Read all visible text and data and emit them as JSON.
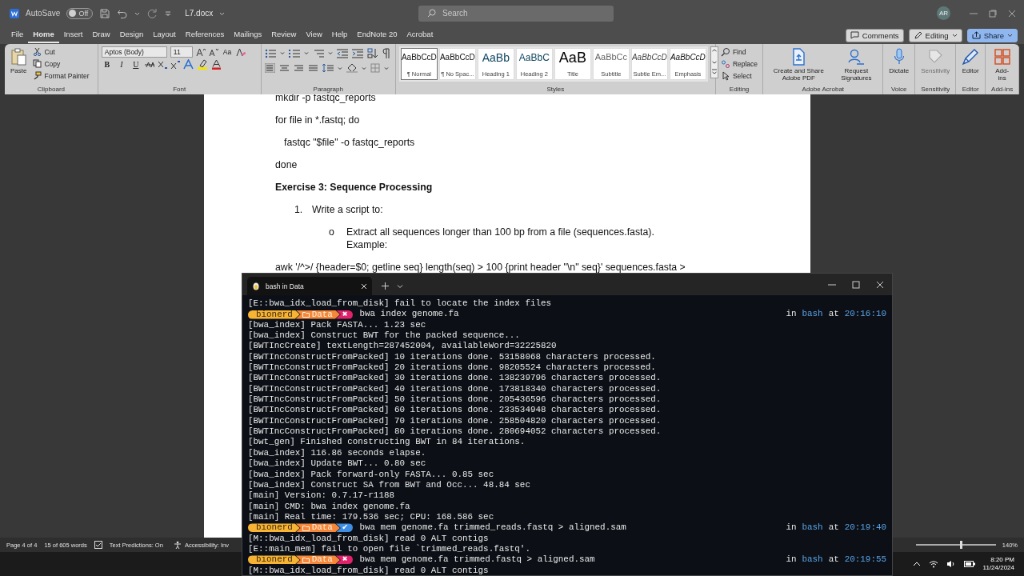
{
  "title_bar": {
    "autosave_label": "AutoSave",
    "autosave": {
      "label": "Off",
      "on": false
    },
    "document_name": "L7.docx",
    "search": {
      "placeholder": "Search"
    },
    "avatar": "AR"
  },
  "ribbon_tabs": [
    {
      "label": "File",
      "selected": false
    },
    {
      "label": "Home",
      "selected": true
    },
    {
      "label": "Insert",
      "selected": false
    },
    {
      "label": "Draw",
      "selected": false
    },
    {
      "label": "Design",
      "selected": false
    },
    {
      "label": "Layout",
      "selected": false
    },
    {
      "label": "References",
      "selected": false
    },
    {
      "label": "Mailings",
      "selected": false
    },
    {
      "label": "Review",
      "selected": false
    },
    {
      "label": "View",
      "selected": false
    },
    {
      "label": "Help",
      "selected": false
    },
    {
      "label": "EndNote 20",
      "selected": false
    },
    {
      "label": "Acrobat",
      "selected": false
    }
  ],
  "ribbon_actions": [
    {
      "label": "Comments",
      "kind": "comments"
    },
    {
      "label": "Editing",
      "kind": "editing"
    },
    {
      "label": "Share",
      "kind": "share"
    }
  ],
  "ribbon": {
    "clipboard": {
      "label": "Clipboard",
      "paste": "Paste",
      "cut": "Cut",
      "copy": "Copy",
      "format_painter": "Format Painter"
    },
    "font": {
      "label": "Font",
      "font_name": "Aptos (Body)",
      "font_size": "11",
      "change_case": "Aa",
      "bold": "B",
      "italic": "I",
      "underline": "U"
    },
    "paragraph": {
      "label": "Paragraph"
    },
    "styles": {
      "label": "Styles",
      "items": [
        {
          "preview": "AaBbCcD",
          "name": "¶ Normal",
          "kind": "normal",
          "selected": true
        },
        {
          "preview": "AaBbCcD",
          "name": "¶ No Spac...",
          "kind": "normal",
          "selected": false
        },
        {
          "preview": "AaBb",
          "name": "Heading 1",
          "kind": "heading1",
          "selected": false
        },
        {
          "preview": "AaBbC",
          "name": "Heading 2",
          "kind": "heading2",
          "selected": false
        },
        {
          "preview": "AaB",
          "name": "Title",
          "kind": "title",
          "selected": false
        },
        {
          "preview": "AaBbCc",
          "name": "Subtitle",
          "kind": "subtitle",
          "selected": false
        },
        {
          "preview": "AaBbCcD",
          "name": "Subtle Em...",
          "kind": "subtle",
          "selected": false
        },
        {
          "preview": "AaBbCcD",
          "name": "Emphasis",
          "kind": "emphasis",
          "selected": false
        }
      ]
    },
    "editing": {
      "label": "Editing",
      "items": [
        {
          "label": "Find",
          "kind": "find"
        },
        {
          "label": "Replace",
          "kind": "replace"
        },
        {
          "label": "Select",
          "kind": "select"
        }
      ]
    },
    "groups": [
      {
        "label": "Adobe Acrobat",
        "buttons": [
          {
            "label": "Create and Share Adobe PDF",
            "kind": "pdf",
            "disabled": false
          },
          {
            "label": "Request Signatures",
            "kind": "sign",
            "disabled": false
          }
        ]
      },
      {
        "label": "Voice",
        "buttons": [
          {
            "label": "Dictate",
            "kind": "mic",
            "disabled": false
          }
        ]
      },
      {
        "label": "Sensitivity",
        "buttons": [
          {
            "label": "Sensitivity",
            "kind": "sensitivity",
            "disabled": true
          }
        ]
      },
      {
        "label": "Editor",
        "buttons": [
          {
            "label": "Editor",
            "kind": "editor",
            "disabled": false
          }
        ]
      },
      {
        "label": "Add-ins",
        "buttons": [
          {
            "label": "Add-ins",
            "kind": "addins",
            "disabled": false
          }
        ]
      }
    ]
  },
  "document": {
    "paragraphs": [
      {
        "kind": "plain",
        "text": "mkdir -p fastqc_reports"
      },
      {
        "kind": "plain",
        "text": "for file in *.fastq; do"
      },
      {
        "kind": "indented",
        "text": "fastqc \"$file\" -o fastqc_reports"
      },
      {
        "kind": "plain",
        "text": "done"
      },
      {
        "kind": "heading",
        "text": "Exercise 3: Sequence Processing"
      },
      {
        "kind": "numbered",
        "marker": "1.",
        "text": "Write a script to:"
      },
      {
        "kind": "bullet",
        "marker": "o",
        "text": "Extract all sequences longer than 100 bp from a file (sequences.fasta). Example:"
      },
      {
        "kind": "plain",
        "text": "awk '/^>/ {header=$0; getline seq} length(seq) > 100 {print header \"\\n\" seq}' sequences.fasta >"
      }
    ]
  },
  "terminal": {
    "tab_title": "bash in Data",
    "lines": [
      {
        "kind": "output",
        "text": "[E::bwa_idx_load_from_disk] fail to locate the index files"
      },
      {
        "kind": "prompt",
        "user": "bionerd",
        "dir": "Data",
        "failed": true,
        "status_symbol": "✖",
        "command": "bwa index genome.fa",
        "right": [
          {
            "text": "in",
            "accent": false
          },
          {
            "text": "bash",
            "accent": true
          },
          {
            "text": "at",
            "accent": false
          },
          {
            "text": "20:16:10",
            "accent": true
          }
        ]
      },
      {
        "kind": "output",
        "text": "[bwa_index] Pack FASTA... 1.23 sec"
      },
      {
        "kind": "output",
        "text": "[bwa_index] Construct BWT for the packed sequence..."
      },
      {
        "kind": "output",
        "text": "[BWTIncCreate] textLength=287452004, availableWord=32225820"
      },
      {
        "kind": "output",
        "text": "[BWTIncConstructFromPacked] 10 iterations done. 53158068 characters processed."
      },
      {
        "kind": "output",
        "text": "[BWTIncConstructFromPacked] 20 iterations done. 98205524 characters processed."
      },
      {
        "kind": "output",
        "text": "[BWTIncConstructFromPacked] 30 iterations done. 138239796 characters processed."
      },
      {
        "kind": "output",
        "text": "[BWTIncConstructFromPacked] 40 iterations done. 173818340 characters processed."
      },
      {
        "kind": "output",
        "text": "[BWTIncConstructFromPacked] 50 iterations done. 205436596 characters processed."
      },
      {
        "kind": "output",
        "text": "[BWTIncConstructFromPacked] 60 iterations done. 233534948 characters processed."
      },
      {
        "kind": "output",
        "text": "[BWTIncConstructFromPacked] 70 iterations done. 258504820 characters processed."
      },
      {
        "kind": "output",
        "text": "[BWTIncConstructFromPacked] 80 iterations done. 280694052 characters processed."
      },
      {
        "kind": "output",
        "text": "[bwt_gen] Finished constructing BWT in 84 iterations."
      },
      {
        "kind": "output",
        "text": "[bwa_index] 116.86 seconds elapse."
      },
      {
        "kind": "output",
        "text": "[bwa_index] Update BWT... 0.80 sec"
      },
      {
        "kind": "output",
        "text": "[bwa_index] Pack forward-only FASTA... 0.85 sec"
      },
      {
        "kind": "output",
        "text": "[bwa_index] Construct SA from BWT and Occ... 48.84 sec"
      },
      {
        "kind": "output",
        "text": "[main] Version: 0.7.17-r1188"
      },
      {
        "kind": "output",
        "text": "[main] CMD: bwa index genome.fa"
      },
      {
        "kind": "output",
        "text": "[main] Real time: 179.536 sec; CPU: 168.586 sec"
      },
      {
        "kind": "prompt",
        "user": "bionerd",
        "dir": "Data",
        "failed": false,
        "status_symbol": "✔",
        "command": "bwa mem genome.fa trimmed_reads.fastq > aligned.sam",
        "right": [
          {
            "text": "in",
            "accent": false
          },
          {
            "text": "bash",
            "accent": true
          },
          {
            "text": "at",
            "accent": false
          },
          {
            "text": "20:19:40",
            "accent": true
          }
        ]
      },
      {
        "kind": "output",
        "text": "[M::bwa_idx_load_from_disk] read 0 ALT contigs"
      },
      {
        "kind": "output",
        "text": "[E::main_mem] fail to open file `trimmed_reads.fastq'."
      },
      {
        "kind": "prompt",
        "user": "bionerd",
        "dir": "Data",
        "failed": true,
        "status_symbol": "✖",
        "command": "bwa mem genome.fa trimmed.fastq > aligned.sam",
        "right": [
          {
            "text": "in",
            "accent": false
          },
          {
            "text": "bash",
            "accent": true
          },
          {
            "text": "at",
            "accent": false
          },
          {
            "text": "20:19:55",
            "accent": true
          }
        ]
      },
      {
        "kind": "output",
        "text": "[M::bwa_idx_load_from_disk] read 0 ALT contigs"
      }
    ]
  },
  "status_bar": {
    "items": [
      {
        "kind": "text",
        "text": "Page 4 of 4"
      },
      {
        "kind": "text",
        "text": "15 of 605 words"
      },
      {
        "kind": "proofing"
      },
      {
        "kind": "text",
        "text": "Text Predictions: On"
      },
      {
        "kind": "accessibility",
        "text": "Accessibility: Inv"
      }
    ],
    "zoom": {
      "level": 0.55,
      "reading": "140%"
    }
  },
  "taskbar": {
    "time": "8:20 PM",
    "date": "11/24/2024"
  }
}
